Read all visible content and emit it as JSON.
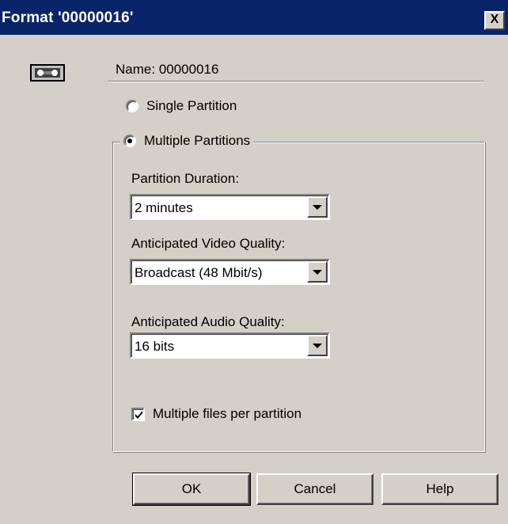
{
  "window": {
    "title": "Format '00000016'",
    "close_glyph": "X"
  },
  "header": {
    "icon": "videotape-icon",
    "name_label": "Name:",
    "name_value": "00000016"
  },
  "partition_mode": {
    "single_label": "Single Partition",
    "multiple_label": "Multiple Partitions",
    "selected": "multiple"
  },
  "fields": {
    "duration_label": "Partition Duration:",
    "duration_value": "2 minutes",
    "video_label": "Anticipated Video Quality:",
    "video_value": "Broadcast (48 Mbit/s)",
    "audio_label": "Anticipated Audio Quality:",
    "audio_value": "16 bits"
  },
  "options": {
    "multiple_files_label": "Multiple files per partition",
    "multiple_files_checked": true
  },
  "buttons": {
    "ok": "OK",
    "cancel": "Cancel",
    "help": "Help"
  },
  "colors": {
    "titlebar": "#0a246a",
    "face": "#d4d0c8"
  }
}
